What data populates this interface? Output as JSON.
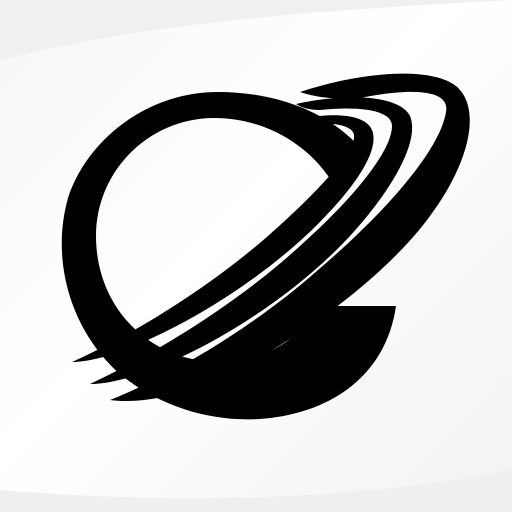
{
  "logo": {
    "icon": "planet-with-rings-icon",
    "description_name": "ringed-planet-logo"
  },
  "colors": {
    "background": "#ffffff",
    "background_shade": "#eeeeee",
    "mark": "#000000"
  }
}
